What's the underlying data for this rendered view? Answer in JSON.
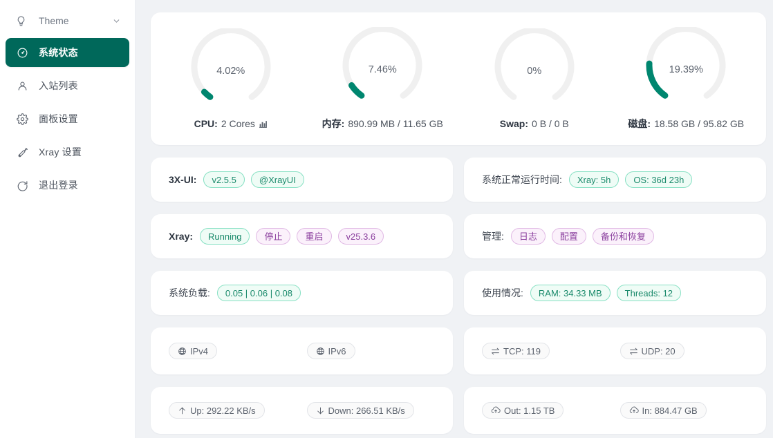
{
  "sidebar": {
    "theme": {
      "label": "Theme",
      "icon": "bulb-icon",
      "chevron": "chevron-down-icon"
    },
    "items": [
      {
        "label": "系统状态",
        "icon": "dashboard-icon",
        "active": true
      },
      {
        "label": "入站列表",
        "icon": "user-icon",
        "active": false
      },
      {
        "label": "面板设置",
        "icon": "gear-icon",
        "active": false
      },
      {
        "label": "Xray 设置",
        "icon": "tool-icon",
        "active": false
      },
      {
        "label": "退出登录",
        "icon": "logout-icon",
        "active": false
      }
    ]
  },
  "gauges": [
    {
      "percent": "4.02%",
      "value": 4.02,
      "label_prefix": "CPU:",
      "label_value": "2 Cores",
      "icon": "bar-chart-icon"
    },
    {
      "percent": "7.46%",
      "value": 7.46,
      "label_prefix": "内存:",
      "label_value": "890.99 MB / 11.65 GB",
      "icon": ""
    },
    {
      "percent": "0%",
      "value": 0,
      "label_prefix": "Swap:",
      "label_value": "0 B / 0 B",
      "icon": ""
    },
    {
      "percent": "19.39%",
      "value": 19.39,
      "label_prefix": "磁盘:",
      "label_value": "18.58 GB / 95.82 GB",
      "icon": ""
    }
  ],
  "rows": {
    "xui": {
      "label": "3X-UI:",
      "tags": [
        {
          "text": "v2.5.5",
          "style": "green"
        },
        {
          "text": "@XrayUI",
          "style": "green"
        }
      ]
    },
    "uptime": {
      "label": "系统正常运行时间:",
      "tags": [
        {
          "text": "Xray: 5h",
          "style": "green"
        },
        {
          "text": "OS: 36d 23h",
          "style": "green"
        }
      ]
    },
    "xray": {
      "label": "Xray:",
      "tags": [
        {
          "text": "Running",
          "style": "green"
        },
        {
          "text": "停止",
          "style": "purple"
        },
        {
          "text": "重启",
          "style": "purple"
        },
        {
          "text": "v25.3.6",
          "style": "purple"
        }
      ]
    },
    "manage": {
      "label": "管理:",
      "tags": [
        {
          "text": "日志",
          "style": "purple"
        },
        {
          "text": "配置",
          "style": "purple"
        },
        {
          "text": "备份和恢复",
          "style": "purple"
        }
      ]
    },
    "sysload": {
      "label": "系统负载:",
      "tags": [
        {
          "text": "0.05 | 0.06 | 0.08",
          "style": "green"
        }
      ]
    },
    "usage": {
      "label": "使用情况:",
      "tags": [
        {
          "text": "RAM: 34.33 MB",
          "style": "green"
        },
        {
          "text": "Threads: 12",
          "style": "green"
        }
      ]
    },
    "ip": {
      "left": {
        "text": "IPv4",
        "style": "neutral",
        "icon": "globe-icon"
      },
      "right": {
        "text": "IPv6",
        "style": "neutral",
        "icon": "globe-icon"
      }
    },
    "conn": {
      "left": {
        "text": "TCP: 119",
        "style": "neutral",
        "icon": "swap-icon"
      },
      "right": {
        "text": "UDP: 20",
        "style": "neutral",
        "icon": "swap-icon"
      }
    },
    "speed": {
      "left": {
        "text": "Up: 292.22 KB/s",
        "style": "neutral",
        "icon": "arrow-up-icon"
      },
      "right": {
        "text": "Down: 266.51 KB/s",
        "style": "neutral",
        "icon": "arrow-down-icon"
      }
    },
    "total": {
      "left": {
        "text": "Out: 1.15 TB",
        "style": "neutral",
        "icon": "cloud-upload-icon"
      },
      "right": {
        "text": "In: 884.47 GB",
        "style": "neutral",
        "icon": "cloud-download-icon"
      }
    }
  },
  "colors": {
    "accent": "#00685a",
    "gauge_stroke": "#00866f",
    "gauge_track": "#f0f0f0",
    "page_bg": "#f0f2f5",
    "tag_green": "#1a8a6b",
    "tag_purple": "#8b3f9e"
  }
}
